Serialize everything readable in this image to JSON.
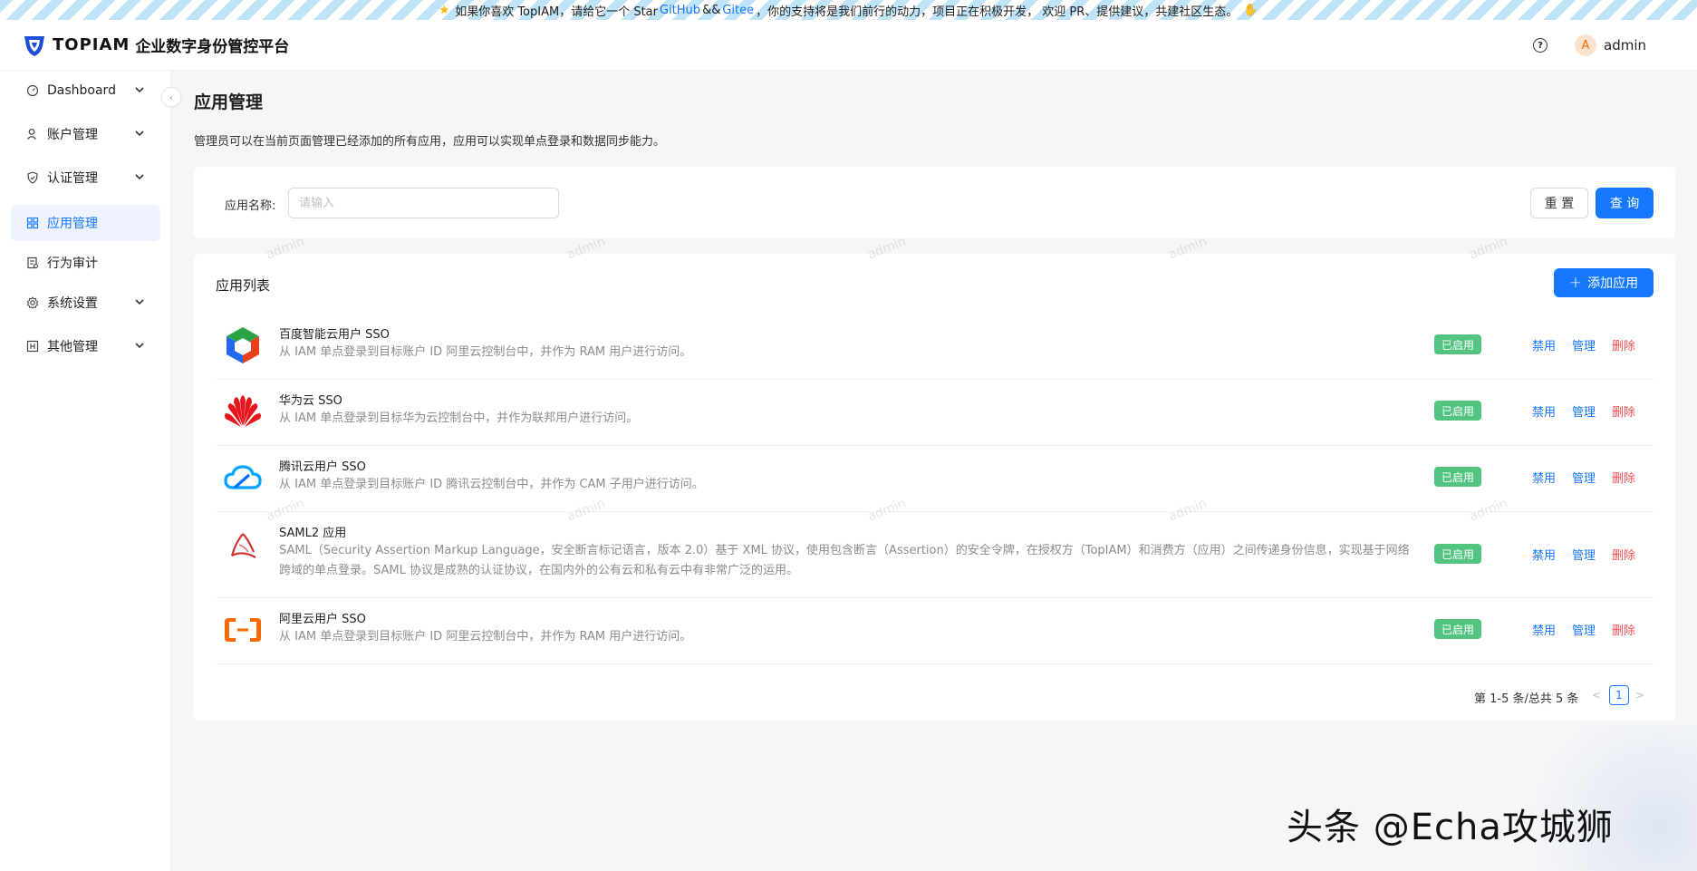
{
  "banner": {
    "text_before": "如果你喜欢 TopIAM，请给它一个 Star",
    "github": "GitHub",
    "amp": "&&",
    "gitee": "Gitee",
    "text_after": "，你的支持将是我们前行的动力，项目正在积极开发， 欢迎 PR、提供建议，共建社区生态。"
  },
  "header": {
    "logo_text": "TOPIAM",
    "subtitle": "企业数字身份管控平台",
    "help_icon": "question-circle-icon",
    "avatar_letter": "A",
    "username": "admin"
  },
  "sidebar": {
    "items": [
      {
        "label": "Dashboard",
        "icon": "dashboard-icon",
        "has_children": true
      },
      {
        "label": "账户管理",
        "icon": "user-icon",
        "has_children": true
      },
      {
        "label": "认证管理",
        "icon": "shield-icon",
        "has_children": true
      },
      {
        "label": "应用管理",
        "icon": "apps-icon",
        "has_children": false,
        "active": true
      },
      {
        "label": "行为审计",
        "icon": "audit-icon",
        "has_children": false
      },
      {
        "label": "系统设置",
        "icon": "gear-icon",
        "has_children": true
      },
      {
        "label": "其他管理",
        "icon": "box-icon",
        "has_children": true
      }
    ],
    "collapse_icon": "chevron-left-icon"
  },
  "main": {
    "title": "应用管理",
    "description": "管理员可以在当前页面管理已经添加的所有应用，应用可以实现单点登录和数据同步能力。",
    "search": {
      "label": "应用名称:",
      "placeholder": "请输入",
      "value": "",
      "reset_label": "重 置",
      "query_label": "查 询"
    },
    "list": {
      "title": "应用列表",
      "add_label": "添加应用",
      "apps": [
        {
          "name": "百度智能云用户 SSO",
          "desc": "从 IAM 单点登录到目标账户 ID 阿里云控制台中，并作为 RAM 用户进行访问。",
          "status": "已启用",
          "logo": "baidu-cloud-logo"
        },
        {
          "name": "华为云 SSO",
          "desc": "从 IAM 单点登录到目标华为云控制台中，并作为联邦用户进行访问。",
          "status": "已启用",
          "logo": "huawei-cloud-logo"
        },
        {
          "name": "腾讯云用户 SSO",
          "desc": "从 IAM 单点登录到目标账户 ID 腾讯云控制台中，并作为 CAM 子用户进行访问。",
          "status": "已启用",
          "logo": "tencent-cloud-logo"
        },
        {
          "name": "SAML2 应用",
          "desc": "SAML（Security Assertion Markup Language，安全断言标记语言，版本 2.0）基于 XML 协议，使用包含断言（Assertion）的安全令牌，在授权方（TopIAM）和消费方（应用）之间传递身份信息，实现基于网络跨域的单点登录。SAML 协议是成熟的认证协议，在国内外的公有云和私有云中有非常广泛的运用。",
          "status": "已启用",
          "logo": "saml-logo"
        },
        {
          "name": "阿里云用户 SSO",
          "desc": "从 IAM 单点登录到目标账户 ID 阿里云控制台中，并作为 RAM 用户进行访问。",
          "status": "已启用",
          "logo": "aliyun-logo"
        }
      ],
      "actions": {
        "disable": "禁用",
        "manage": "管理",
        "delete": "删除"
      },
      "pagination": {
        "info": "第 1-5 条/总共 5 条",
        "current": "1"
      }
    }
  },
  "watermark_text": "admin",
  "overlay_mark": "头条 @Echa攻城狮",
  "colors": {
    "primary": "#1677ff",
    "success": "#52c480",
    "danger": "#ff4d4f"
  }
}
